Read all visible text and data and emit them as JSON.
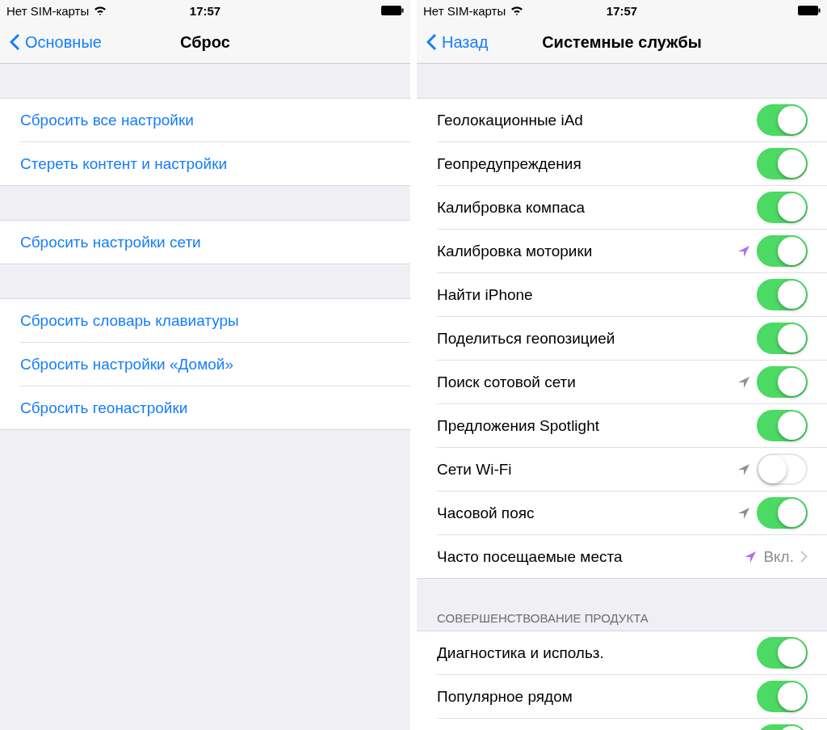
{
  "screens": [
    {
      "status_bar": {
        "carrier": "Нет SIM-карты",
        "time": "17:57"
      },
      "nav": {
        "back": "Основные",
        "title": "Сброс"
      },
      "groups": [
        {
          "items": [
            {
              "label": "Сбросить все настройки"
            },
            {
              "label": "Стереть контент и настройки"
            }
          ]
        },
        {
          "items": [
            {
              "label": "Сбросить настройки сети"
            }
          ]
        },
        {
          "items": [
            {
              "label": "Сбросить словарь клавиатуры"
            },
            {
              "label": "Сбросить настройки «Домой»"
            },
            {
              "label": "Сбросить геонастройки"
            }
          ]
        }
      ]
    },
    {
      "status_bar": {
        "carrier": "Нет SIM-карты",
        "time": "17:57"
      },
      "nav": {
        "back": "Назад",
        "title": "Системные службы"
      },
      "groups": [
        {
          "items": [
            {
              "kind": "toggle",
              "label": "Геолокационные iAd",
              "on": true
            },
            {
              "kind": "toggle",
              "label": "Геопредупреждения",
              "on": true
            },
            {
              "kind": "toggle",
              "label": "Калибровка компаса",
              "on": true
            },
            {
              "kind": "toggle",
              "label": "Калибровка моторики",
              "on": true,
              "color": "#b36bf5"
            },
            {
              "kind": "toggle",
              "label": "Найти iPhone",
              "on": true
            },
            {
              "kind": "toggle",
              "label": "Поделиться геопозицией",
              "on": true
            },
            {
              "kind": "toggle",
              "label": "Поиск сотовой сети",
              "on": true,
              "color": "#8e8e93"
            },
            {
              "kind": "toggle",
              "label": "Предложения Spotlight",
              "on": true
            },
            {
              "kind": "toggle",
              "label": "Сети Wi-Fi",
              "on": false,
              "color": "#8e8e93"
            },
            {
              "kind": "toggle",
              "label": "Часовой пояс",
              "on": true,
              "color": "#8e8e93"
            },
            {
              "kind": "detail",
              "label": "Часто посещаемые места",
              "value": "Вкл.",
              "color": "#b36bf5"
            }
          ]
        },
        {
          "header": "СОВЕРШЕНСТВОВАНИЕ ПРОДУКТА",
          "items": [
            {
              "kind": "toggle",
              "label": "Диагностика и использ.",
              "on": true
            },
            {
              "kind": "toggle",
              "label": "Популярное рядом",
              "on": true
            },
            {
              "kind": "toggle",
              "on": true
            }
          ]
        }
      ]
    }
  ]
}
